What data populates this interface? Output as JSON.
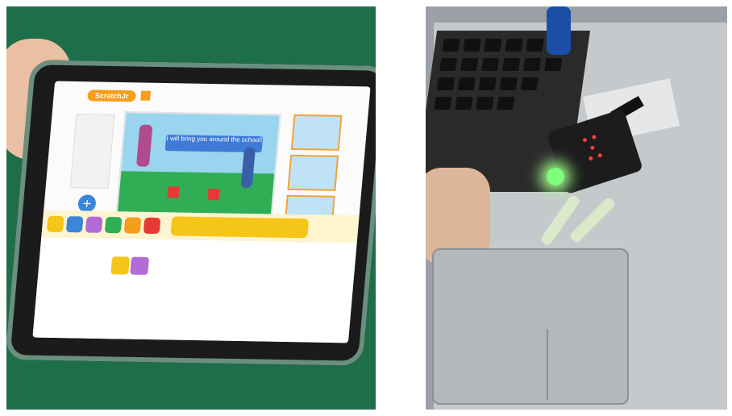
{
  "left_photo": {
    "app_logo_text": "ScratchJr",
    "speech_bubble": "I will bring you around the school!",
    "colors": {
      "background": "#1f6e4a",
      "accent": "#f59d1c",
      "blocks_bar": "#fff4d0"
    },
    "icons": [
      "home-icon",
      "green-flag-icon",
      "add-icon",
      "stage-thumbnail-icon",
      "block-category-icon"
    ]
  },
  "right_photo": {
    "colors": {
      "laptop": "#c5c9cc",
      "board": "#1c1c1c",
      "led": "#7dff7a"
    },
    "icons": [
      "microbit-board",
      "green-led",
      "usb-cable",
      "crocodile-clip"
    ]
  }
}
